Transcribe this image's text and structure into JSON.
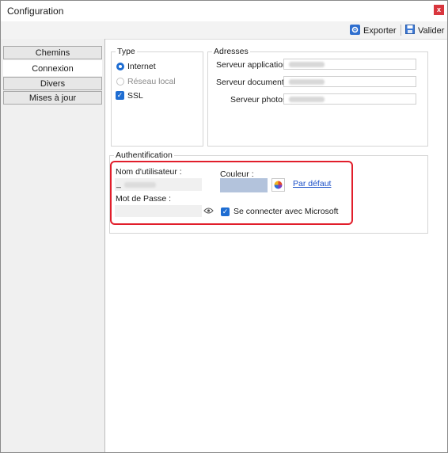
{
  "window": {
    "title": "Configuration",
    "close_label": "x"
  },
  "toolbar": {
    "export_label": "Exporter",
    "validate_label": "Valider"
  },
  "nav": {
    "items": [
      {
        "label": "Chemins"
      },
      {
        "label": "Connexion"
      },
      {
        "label": "Divers"
      },
      {
        "label": "Mises à jour"
      }
    ],
    "active": "Connexion"
  },
  "type_group": {
    "legend": "Type",
    "internet_label": "Internet",
    "reseau_label": "Réseau local",
    "ssl_label": "SSL"
  },
  "addresses_group": {
    "legend": "Adresses",
    "app_server_label": "Serveur application",
    "docs_server_label": "Serveur documents",
    "photos_server_label": "Serveur photos"
  },
  "auth_group": {
    "legend": "Authentification",
    "username_label": "Nom d'utilisateur :",
    "username_value": "_",
    "password_label": "Mot de Passe :",
    "color_label": "Couleur :",
    "default_link": "Par défaut",
    "microsoft_label": "Se connecter avec Microsoft"
  },
  "colors": {
    "accent": "#1e6dd2",
    "highlight": "#e11e2b",
    "color_swatch": "#b3c3dc"
  }
}
